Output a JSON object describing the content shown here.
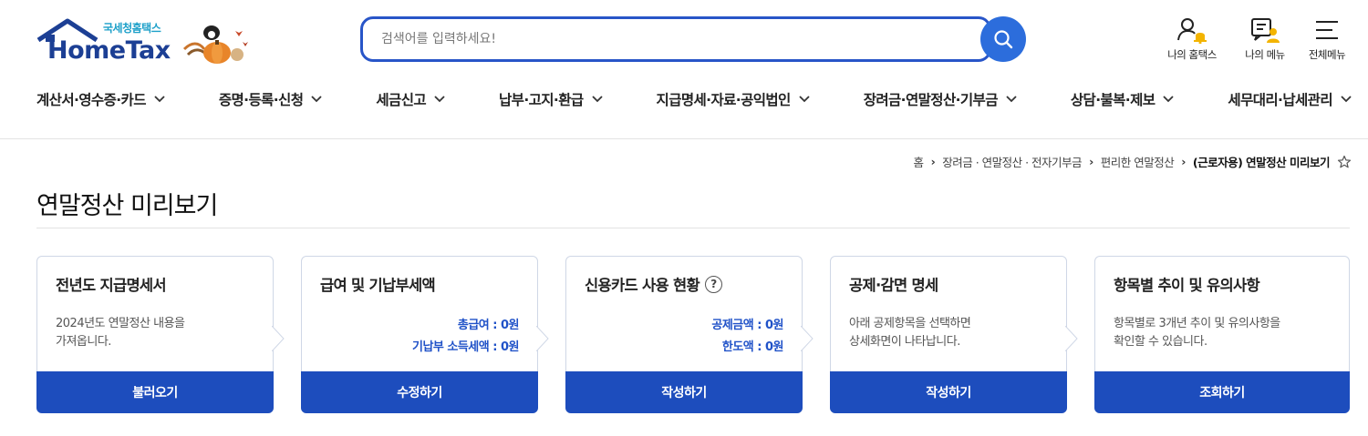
{
  "brand": {
    "title": "HomeTax",
    "subtitle": "국세청홈택스"
  },
  "search": {
    "placeholder": "검색어를 입력하세요!"
  },
  "utility": [
    {
      "label": "나의 홈택스",
      "icon": "user-bell-icon"
    },
    {
      "label": "나의 메뉴",
      "icon": "my-menu-icon"
    },
    {
      "label": "전체메뉴",
      "icon": "hamburger-menu-icon"
    }
  ],
  "nav": [
    "계산서·영수증·카드",
    "증명·등록·신청",
    "세금신고",
    "납부·고지·환급",
    "지급명세·자료·공익법인",
    "장려금·연말정산·기부금",
    "상담·불복·제보",
    "세무대리·납세관리"
  ],
  "breadcrumb": {
    "items": [
      "홈",
      "장려금 · 연말정산 · 전자기부금",
      "편리한 연말정산"
    ],
    "current": "(근로자용) 연말정산 미리보기"
  },
  "page_title": "연말정산 미리보기",
  "cards": [
    {
      "title": "전년도 지급명세서",
      "desc": [
        "2024년도 연말정산 내용을",
        "가져옵니다."
      ],
      "vals": [],
      "button": "불러오기"
    },
    {
      "title": "급여 및 기납부세액",
      "desc": [],
      "vals": [
        "총급여 : 0원",
        "기납부 소득세액 : 0원"
      ],
      "button": "수정하기"
    },
    {
      "title": "신용카드 사용 현황",
      "help": "?",
      "desc": [],
      "vals": [
        "공제금액 : 0원",
        "한도액 : 0원"
      ],
      "button": "작성하기"
    },
    {
      "title": "공제·감면 명세",
      "desc": [
        "아래 공제항목을 선택하면",
        "상세화면이 나타납니다."
      ],
      "vals": [],
      "button": "작성하기"
    },
    {
      "title": "항목별 추이 및 유의사항",
      "desc": [
        "항목별로 3개년 추이 및 유의사항을",
        "확인할 수 있습니다."
      ],
      "vals": [],
      "button": "조회하기"
    }
  ],
  "colors": {
    "primary": "#1d4dbd",
    "search_border": "#2855c8",
    "value_text": "#2052c8",
    "logo": "#1c3f94"
  }
}
